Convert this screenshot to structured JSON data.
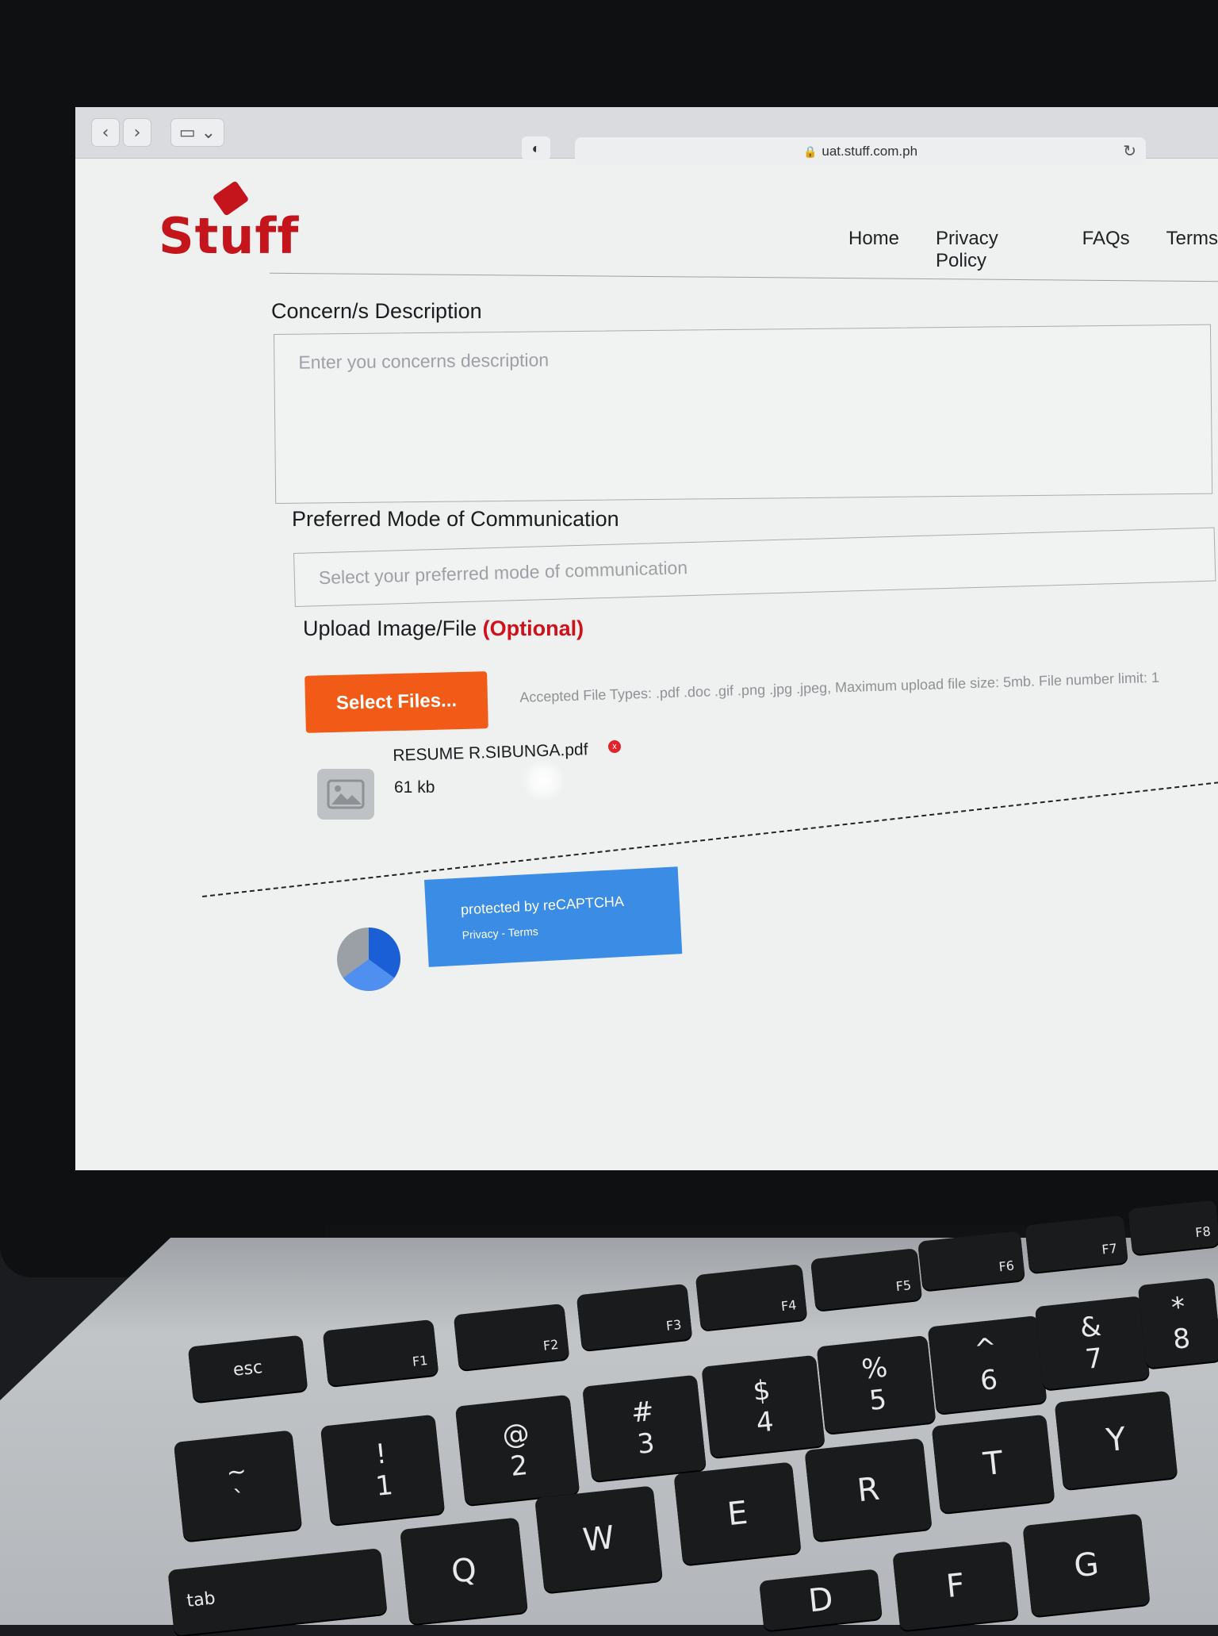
{
  "browser": {
    "url": "uat.stuff.com.ph",
    "lock_icon": "lock-icon",
    "back_icon": "chevron-left-icon",
    "forward_icon": "chevron-right-icon",
    "sidebar_icon": "sidebar-icon",
    "shield_icon": "shield-icon",
    "reload_icon": "reload-icon"
  },
  "site": {
    "logo": "Stuff",
    "nav": [
      "Home",
      "Privacy Policy",
      "FAQs",
      "Terms"
    ]
  },
  "form": {
    "concerns": {
      "label": "Concern/s Description",
      "placeholder": "Enter you concerns description"
    },
    "communication": {
      "label": "Preferred Mode of Communication",
      "placeholder": "Select your preferred mode of communication"
    },
    "upload": {
      "label": "Upload Image/File",
      "optional": "(Optional)",
      "button": "Select Files...",
      "note": "Accepted File Types: .pdf .doc .gif .png .jpg .jpeg, Maximum upload file size: 5mb. File number limit: 1",
      "file_name": "RESUME R.SIBUNGA.pdf",
      "file_size": "61 kb",
      "remove": "x"
    },
    "recaptcha": {
      "text": "protected by reCAPTCHA",
      "links": "Privacy - Terms"
    }
  },
  "keyboard": {
    "fn_row": [
      "esc",
      "F1",
      "F2",
      "F3",
      "F4",
      "F5",
      "F6",
      "F7",
      "F8"
    ],
    "num_row": [
      [
        "~",
        "`"
      ],
      [
        "!",
        "1"
      ],
      [
        "@",
        "2"
      ],
      [
        "#",
        "3"
      ],
      [
        "$",
        "4"
      ],
      [
        "%",
        "5"
      ],
      [
        "^",
        "6"
      ],
      [
        "&",
        "7"
      ],
      [
        "*",
        "8"
      ]
    ],
    "letters_top": [
      "Q",
      "W",
      "E",
      "R",
      "T",
      "Y"
    ],
    "letters_mid": [
      "D",
      "F",
      "G"
    ],
    "tab": "tab"
  },
  "colors": {
    "brand_red": "#c4151c",
    "button_orange": "#f15a17",
    "recaptcha_blue": "#3b8ce4"
  }
}
